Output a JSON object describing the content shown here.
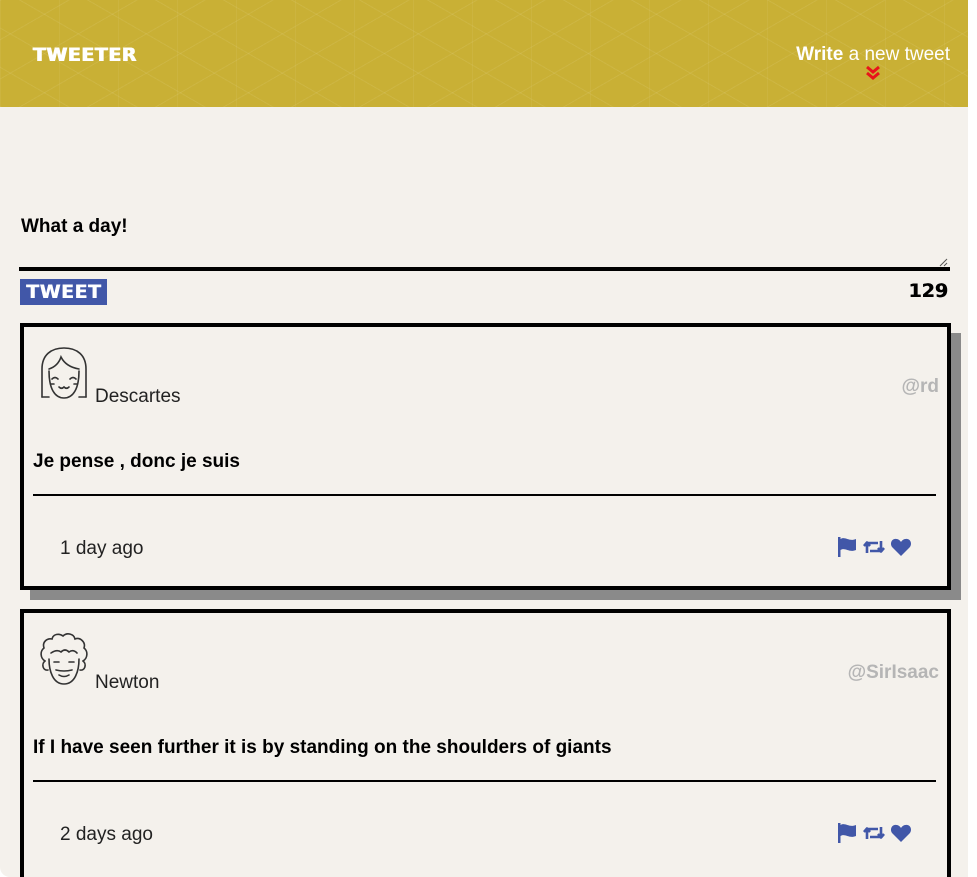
{
  "nav": {
    "brand": "TWEETER",
    "compose_toggle": {
      "bold_part": "Write",
      "rest": " a new tweet"
    },
    "icons": {
      "toggle": "double-chevron-down-icon"
    },
    "colors": {
      "nav_bg": "#c9b035",
      "chevron": "#e8141b"
    }
  },
  "compose": {
    "text": "What a day!",
    "button_label": "TWEET",
    "counter": "129",
    "colors": {
      "button_bg": "#4157a8"
    }
  },
  "tweets": [
    {
      "name": "Descartes",
      "handle": "@rd",
      "content": "Je pense , donc je suis",
      "timestamp": "1 day ago",
      "avatar": "girl-avatar-icon",
      "actions": [
        "flag-icon",
        "retweet-icon",
        "heart-icon"
      ]
    },
    {
      "name": "Newton",
      "handle": "@SirIsaac",
      "content": "If I have seen further it is by standing on the shoulders of giants",
      "timestamp": "2 days ago",
      "avatar": "curly-hair-avatar-icon",
      "actions": [
        "flag-icon",
        "retweet-icon",
        "heart-icon"
      ]
    }
  ],
  "colors": {
    "page_bg": "#f4f1ec",
    "icon_blue": "#4157a8",
    "handle_gray": "#b5b5b5"
  }
}
